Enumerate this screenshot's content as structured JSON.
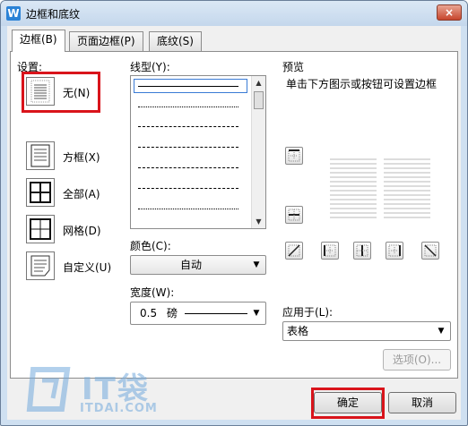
{
  "window": {
    "title": "边框和底纹",
    "close_glyph": "×"
  },
  "tabs": [
    {
      "label": "边框(B)",
      "active": true
    },
    {
      "label": "页面边框(P)",
      "active": false
    },
    {
      "label": "底纹(S)",
      "active": false
    }
  ],
  "settings": {
    "title": "设置:",
    "items": [
      {
        "label": "无(N)",
        "icon": "border-none-icon"
      },
      {
        "label": "方框(X)",
        "icon": "border-box-icon"
      },
      {
        "label": "全部(A)",
        "icon": "border-all-icon"
      },
      {
        "label": "网格(D)",
        "icon": "border-grid-icon"
      },
      {
        "label": "自定义(U)",
        "icon": "border-custom-icon"
      }
    ]
  },
  "line_style": {
    "label": "线型(Y):",
    "options": [
      "solid",
      "dotted",
      "dashed",
      "dense-dashed",
      "long-dashed",
      "dash-dot",
      "dash-dot-dot"
    ]
  },
  "color": {
    "label": "颜色(C):",
    "value": "自动"
  },
  "width": {
    "label": "宽度(W):",
    "value_num": "0.5",
    "value_unit": "磅"
  },
  "preview": {
    "title": "预览",
    "hint": "单击下方图示或按钮可设置边框"
  },
  "apply_to": {
    "label": "应用于(L):",
    "value": "表格"
  },
  "buttons": {
    "options": "选项(O)...",
    "ok": "确定",
    "cancel": "取消"
  },
  "watermark": {
    "brand": "IT袋",
    "domain": "ITDAI.COM"
  },
  "colors": {
    "highlight": "#d9141b",
    "titlebar": "#c4d7ec",
    "client_bg": "#f0f0f0"
  }
}
